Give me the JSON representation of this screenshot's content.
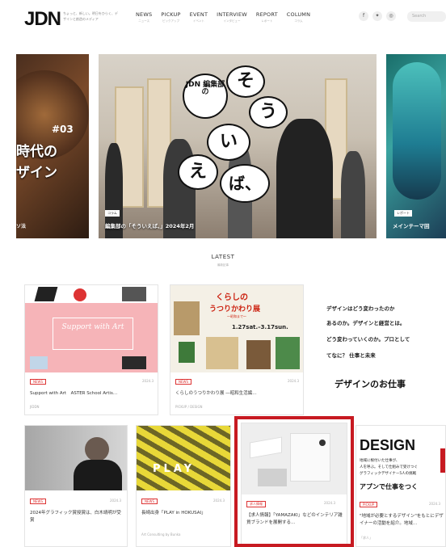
{
  "header": {
    "logo": "JDN",
    "tagline": "ちょっと、新しい。明日をひらく、デザインと創造のメディア",
    "nav": [
      {
        "label": "NEWS",
        "sub": "ニュース"
      },
      {
        "label": "PICKUP",
        "sub": "ピックアップ"
      },
      {
        "label": "EVENT",
        "sub": "イベント"
      },
      {
        "label": "INTERVIEW",
        "sub": "インタビュー"
      },
      {
        "label": "REPORT",
        "sub": "レポート"
      },
      {
        "label": "COLUMN",
        "sub": "コラム"
      }
    ],
    "social": [
      "f",
      "✦",
      "◎"
    ],
    "search_placeholder": "Search"
  },
  "hero": {
    "left_num": "#03",
    "left_text_1": "時代の",
    "left_text_2": "ザイン",
    "left_caption": "ソ法",
    "center_bubble_jdn": "JDN 編集部の",
    "bubbles": [
      "そ",
      "う",
      "い",
      "え",
      "ば、"
    ],
    "center_tag": "コラム",
    "center_caption": "編集部の「そういえば、」2024年2月",
    "right_tag": "レポート",
    "right_caption": "メインテーマ回"
  },
  "latest": {
    "title": "LATEST",
    "sub": "最新記事"
  },
  "cards_row1": [
    {
      "thumb_text": "Support with Art",
      "tag": "NEWS",
      "date": "2024.3",
      "title": "Support with Art　ASTER School Artis…",
      "sub": "JIDDN"
    },
    {
      "thumb_text_1": "くらしの",
      "thumb_text_2": "うつりかわり展",
      "thumb_text_3": "〜昭和まで〜",
      "thumb_date": "1.27sat.–3.17sun.",
      "tag": "NEWS",
      "date": "2024.3",
      "title": "くらしのうつりかわり展 ―昭和生活編…",
      "sub": "PICKUP / DESIGN"
    },
    {
      "lines": [
        "デザインはどう変わったのか",
        "あるのか。デザインと経営とは。",
        "どう変わっていくのか。プロとして",
        "てなに？ 仕事と未来",
        "デザインのお仕事"
      ]
    }
  ],
  "cards_row2": [
    {
      "tag": "NEWS",
      "date": "2024.3",
      "title": "2024年グラフィック賞授賞は、白木靖明が受賞",
      "sub": ""
    },
    {
      "thumb_text": "PLAY",
      "tag": "NEWS",
      "date": "2024.3",
      "title": "長崎出身「PLAY in HOKUSAI」",
      "sub": "Art Consulting by Bunka"
    },
    {
      "tag": "求人情報",
      "date": "2024.3",
      "title": "【求人情報】「YAMAZAKI」などのインテリア雑貨ブランドを展開する…",
      "sub": ""
    },
    {
      "thumb_big": "DESIGN",
      "thumb_line_1": "地域に根付いた仕事が、",
      "thumb_line_2": "人を呼ぶ。そして仕組みで受けつぐ",
      "thumb_line_3": "グラフィックデザイナー5人の挑戦",
      "thumb_line_4": "アプンで仕事をつく",
      "tag": "PICKUP",
      "date": "2024.3",
      "title": "\"地域が必要とするデザイン\"をもとにデザイナーの活動を紹介。地域…",
      "sub": "「求人」"
    }
  ],
  "colors": {
    "accent": "#c71a21",
    "tag_red": "#d33"
  }
}
